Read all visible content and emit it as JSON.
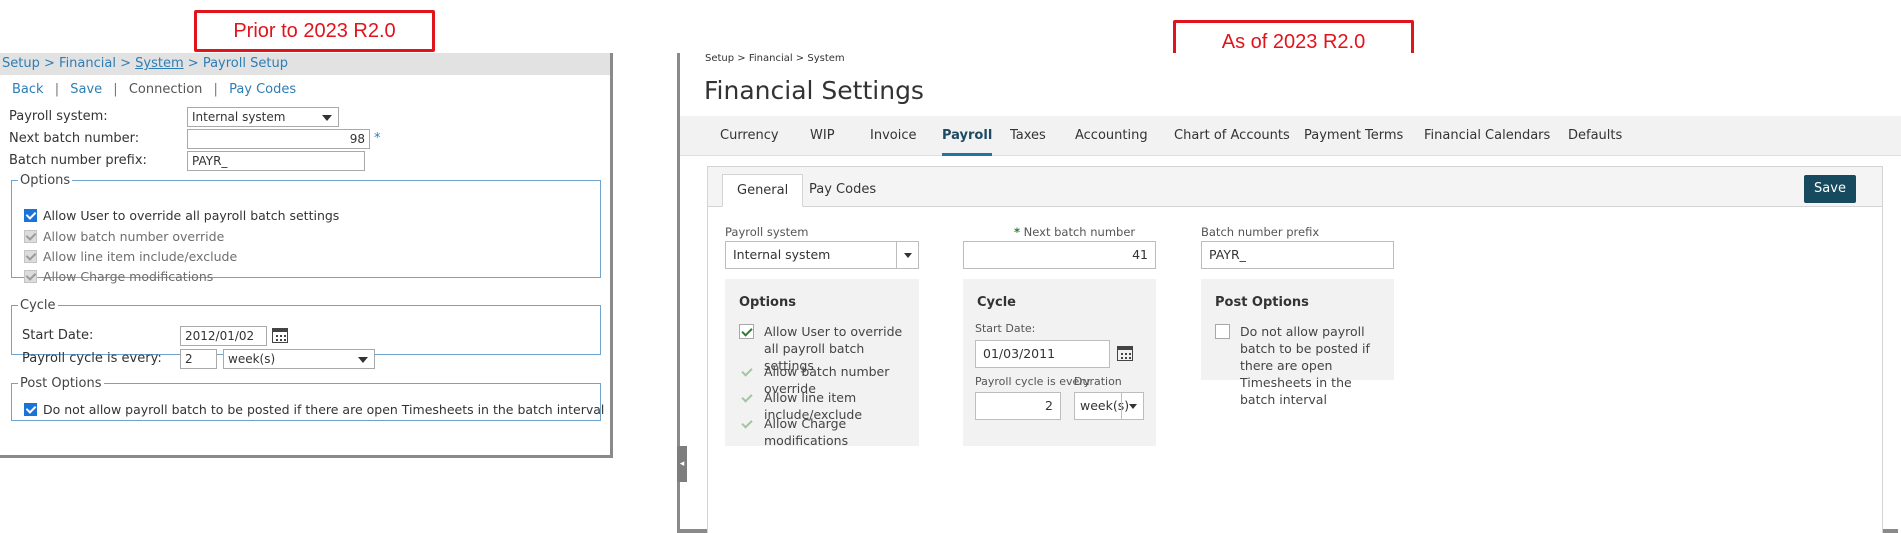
{
  "callouts": {
    "before": "Prior to 2023 R2.0",
    "after": "As of 2023 R2.0"
  },
  "old": {
    "breadcrumb": {
      "setup": "Setup",
      "financial": "Financial",
      "system": "System",
      "current": "Payroll Setup",
      "sep": ">"
    },
    "links": {
      "back": "Back",
      "save": "Save",
      "connection": "Connection",
      "pay_codes": "Pay Codes",
      "sep": "|"
    },
    "fields": {
      "payroll_system_label": "Payroll system:",
      "payroll_system_value": "Internal system",
      "next_batch_label": "Next batch number:",
      "next_batch_value": "98",
      "required_mark": "*",
      "prefix_label": "Batch number prefix:",
      "prefix_value": "PAYR_"
    },
    "options": {
      "legend": "Options",
      "items": [
        {
          "label": "Allow User to override all payroll batch settings",
          "checked": true,
          "disabled": false
        },
        {
          "label": "Allow batch number override",
          "checked": true,
          "disabled": true
        },
        {
          "label": "Allow line item include/exclude",
          "checked": true,
          "disabled": true
        },
        {
          "label": "Allow Charge modifications",
          "checked": true,
          "disabled": true
        }
      ]
    },
    "cycle": {
      "legend": "Cycle",
      "start_label": "Start Date:",
      "start_value": "2012/01/02",
      "every_label": "Payroll cycle is every:",
      "every_value": "2",
      "unit_value": "week(s)"
    },
    "post": {
      "legend": "Post Options",
      "label": "Do not allow payroll batch to be posted if there are open Timesheets in the batch interval",
      "checked": true
    }
  },
  "new": {
    "breadcrumb": "Setup > Financial > System",
    "title": "Financial Settings",
    "tabs": [
      "Currency",
      "WIP",
      "Invoice",
      "Payroll",
      "Taxes",
      "Accounting",
      "Chart of Accounts",
      "Payment Terms",
      "Financial Calendars",
      "Defaults"
    ],
    "active_tab": "Payroll",
    "subtabs": [
      "General",
      "Pay Codes"
    ],
    "save": "Save",
    "fields": {
      "payroll_system_label": "Payroll system",
      "payroll_system_value": "Internal system",
      "required_mark": "*",
      "next_batch_label": "Next batch number",
      "next_batch_value": "41",
      "prefix_label": "Batch number prefix",
      "prefix_value": "PAYR_"
    },
    "options": {
      "title": "Options",
      "items": [
        {
          "label": "Allow User to override all payroll batch settings",
          "checked": true,
          "disabled": false
        },
        {
          "label": "Allow batch number override",
          "checked": true,
          "disabled": true
        },
        {
          "label": "Allow line item include/exclude",
          "checked": true,
          "disabled": true
        },
        {
          "label": "Allow Charge modifications",
          "checked": true,
          "disabled": true
        }
      ]
    },
    "cycle": {
      "title": "Cycle",
      "start_label": "Start Date:",
      "start_value": "01/03/2011",
      "every_label": "Payroll cycle is every",
      "every_value": "2",
      "duration_label": "Duration",
      "duration_value": "week(s)"
    },
    "post": {
      "title": "Post Options",
      "label": "Do not allow payroll batch to be posted if there are open Timesheets in the batch interval",
      "checked": false
    },
    "collapse_glyph": "◂"
  },
  "colors": {
    "accent_red": "#e0141b",
    "link_blue": "#2d7eb5",
    "save_button": "#174a5e",
    "tab_underline": "#2074a8"
  }
}
